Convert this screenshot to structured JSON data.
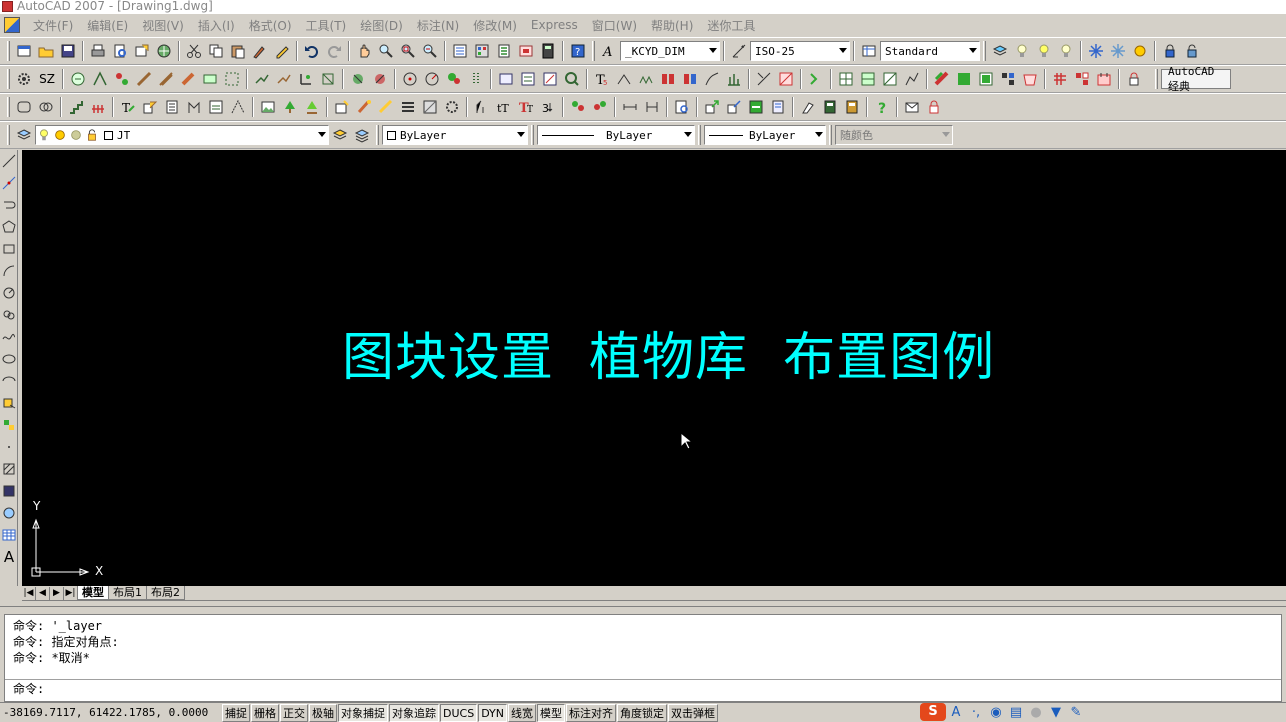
{
  "window": {
    "title": "AutoCAD 2007 - [Drawing1.dwg]"
  },
  "menu": {
    "items": [
      "文件(F)",
      "编辑(E)",
      "视图(V)",
      "插入(I)",
      "格式(O)",
      "工具(T)",
      "绘图(D)",
      "标注(N)",
      "修改(M)",
      "Express",
      "窗口(W)",
      "帮助(H)",
      "迷你工具"
    ]
  },
  "toolbar1": {
    "text_style": "_KCYD_DIM",
    "dim_style": "ISO-25",
    "table_style": "Standard"
  },
  "toolbar2": {
    "sz_label": "SZ",
    "autocad_label": "AutoCAD 经典"
  },
  "layers": {
    "current_layer": "JT",
    "color": "ByLayer",
    "linetype": "ByLayer",
    "lineweight": "ByLayer",
    "plot_style": "随颜色"
  },
  "canvas": {
    "title_text": "图块设置  植物库  布置图例",
    "axis_y": "Y",
    "axis_x": "X"
  },
  "layout_tabs": {
    "items": [
      "模型",
      "布局1",
      "布局2"
    ]
  },
  "command": {
    "history": [
      "命令: '_layer",
      "命令: 指定对角点:",
      "命令: *取消*"
    ],
    "prompt": "命令:"
  },
  "status": {
    "coords": "-38169.7117, 61422.1785, 0.0000",
    "buttons": [
      "捕捉",
      "栅格",
      "正交",
      "极轴",
      "对象捕捉",
      "对象追踪",
      "DUCS",
      "DYN",
      "线宽",
      "模型",
      "标注对齐",
      "角度锁定",
      "双击弹框"
    ]
  },
  "ime": {
    "logo": "S",
    "mode": "A"
  }
}
